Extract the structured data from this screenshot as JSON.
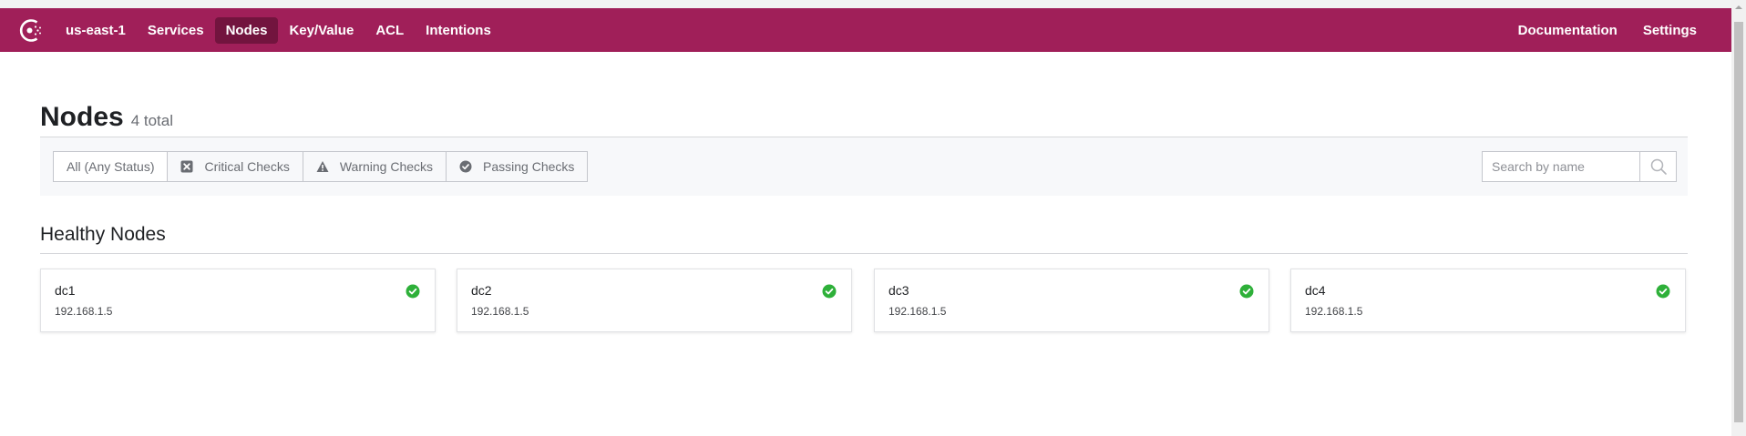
{
  "nav": {
    "datacenter": "us-east-1",
    "items": [
      {
        "label": "Services",
        "active": false
      },
      {
        "label": "Nodes",
        "active": true
      },
      {
        "label": "Key/Value",
        "active": false
      },
      {
        "label": "ACL",
        "active": false
      },
      {
        "label": "Intentions",
        "active": false
      }
    ],
    "right": [
      {
        "label": "Documentation"
      },
      {
        "label": "Settings"
      }
    ]
  },
  "page": {
    "title": "Nodes",
    "count": "4 total"
  },
  "filters": [
    {
      "label": "All (Any Status)",
      "icon": "none",
      "active": true
    },
    {
      "label": "Critical Checks",
      "icon": "critical-x-icon",
      "active": false
    },
    {
      "label": "Warning Checks",
      "icon": "warning-triangle-icon",
      "active": false
    },
    {
      "label": "Passing Checks",
      "icon": "passing-check-icon",
      "active": false
    }
  ],
  "search": {
    "placeholder": "Search by name",
    "value": ""
  },
  "section": {
    "title": "Healthy Nodes"
  },
  "nodes": [
    {
      "name": "dc1",
      "address": "192.168.1.5",
      "status": "passing"
    },
    {
      "name": "dc2",
      "address": "192.168.1.5",
      "status": "passing"
    },
    {
      "name": "dc3",
      "address": "192.168.1.5",
      "status": "passing"
    },
    {
      "name": "dc4",
      "address": "192.168.1.5",
      "status": "passing"
    }
  ],
  "colors": {
    "brand": "#a01f59",
    "brand_active": "#72143e",
    "passing": "#2eb039"
  }
}
